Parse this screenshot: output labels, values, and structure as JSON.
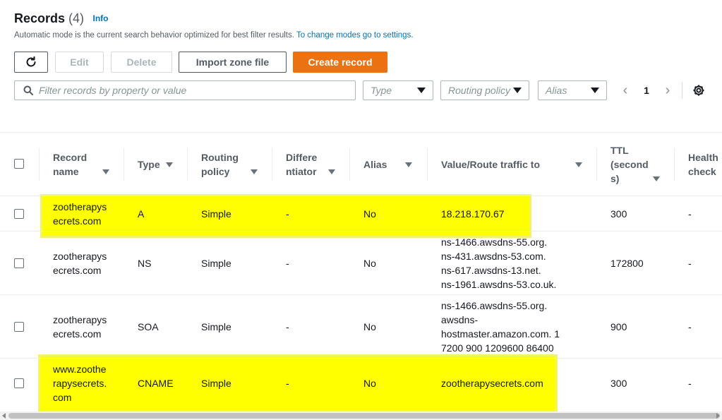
{
  "header": {
    "title": "Records",
    "count": "(4)",
    "info_link": "Info",
    "subtitle": "Automatic mode is the current search behavior optimized for best filter results.",
    "subtitle_link": "To change modes go to settings."
  },
  "toolbar": {
    "edit_label": "Edit",
    "delete_label": "Delete",
    "import_label": "Import zone file",
    "create_label": "Create record"
  },
  "filters": {
    "search_placeholder": "Filter records by property or value",
    "type_placeholder": "Type",
    "routing_placeholder": "Routing policy",
    "alias_placeholder": "Alias"
  },
  "pagination": {
    "page": "1"
  },
  "table": {
    "columns": {
      "record_name": [
        "Record",
        "name"
      ],
      "type": [
        "Type"
      ],
      "routing_policy": [
        "Routing",
        "policy"
      ],
      "differentiator": [
        "Differe",
        "ntiator"
      ],
      "alias": [
        "Alias"
      ],
      "value": [
        "Value/Route traffic to"
      ],
      "ttl": [
        "TTL",
        "(second",
        "s)"
      ],
      "health": [
        "Health",
        "check"
      ]
    },
    "rows": [
      {
        "name": [
          "zootherapys",
          "ecrets.com"
        ],
        "type": "A",
        "routing": "Simple",
        "diff": "-",
        "alias": "No",
        "value": [
          "18.218.170.67"
        ],
        "ttl": "300",
        "health": "-"
      },
      {
        "name": [
          "zootherapys",
          "ecrets.com"
        ],
        "type": "NS",
        "routing": "Simple",
        "diff": "-",
        "alias": "No",
        "value": [
          "ns-1466.awsdns-55.org.",
          "ns-431.awsdns-53.com.",
          "ns-617.awsdns-13.net.",
          "ns-1961.awsdns-53.co.uk."
        ],
        "ttl": "172800",
        "health": "-"
      },
      {
        "name": [
          "zootherapys",
          "ecrets.com"
        ],
        "type": "SOA",
        "routing": "Simple",
        "diff": "-",
        "alias": "No",
        "value": [
          "ns-1466.awsdns-55.org.",
          "awsdns-",
          "hostmaster.amazon.com. 1",
          "7200 900 1209600 86400"
        ],
        "ttl": "900",
        "health": "-"
      },
      {
        "name": [
          "www.zoothe",
          "rapysecrets.",
          "com"
        ],
        "type": "CNAME",
        "routing": "Simple",
        "diff": "-",
        "alias": "No",
        "value": [
          "zootherapysecrets.com"
        ],
        "ttl": "300",
        "health": "-"
      }
    ]
  },
  "colors": {
    "primary": "#ec7211",
    "link": "#0073bb",
    "highlight": "#ffff00"
  }
}
